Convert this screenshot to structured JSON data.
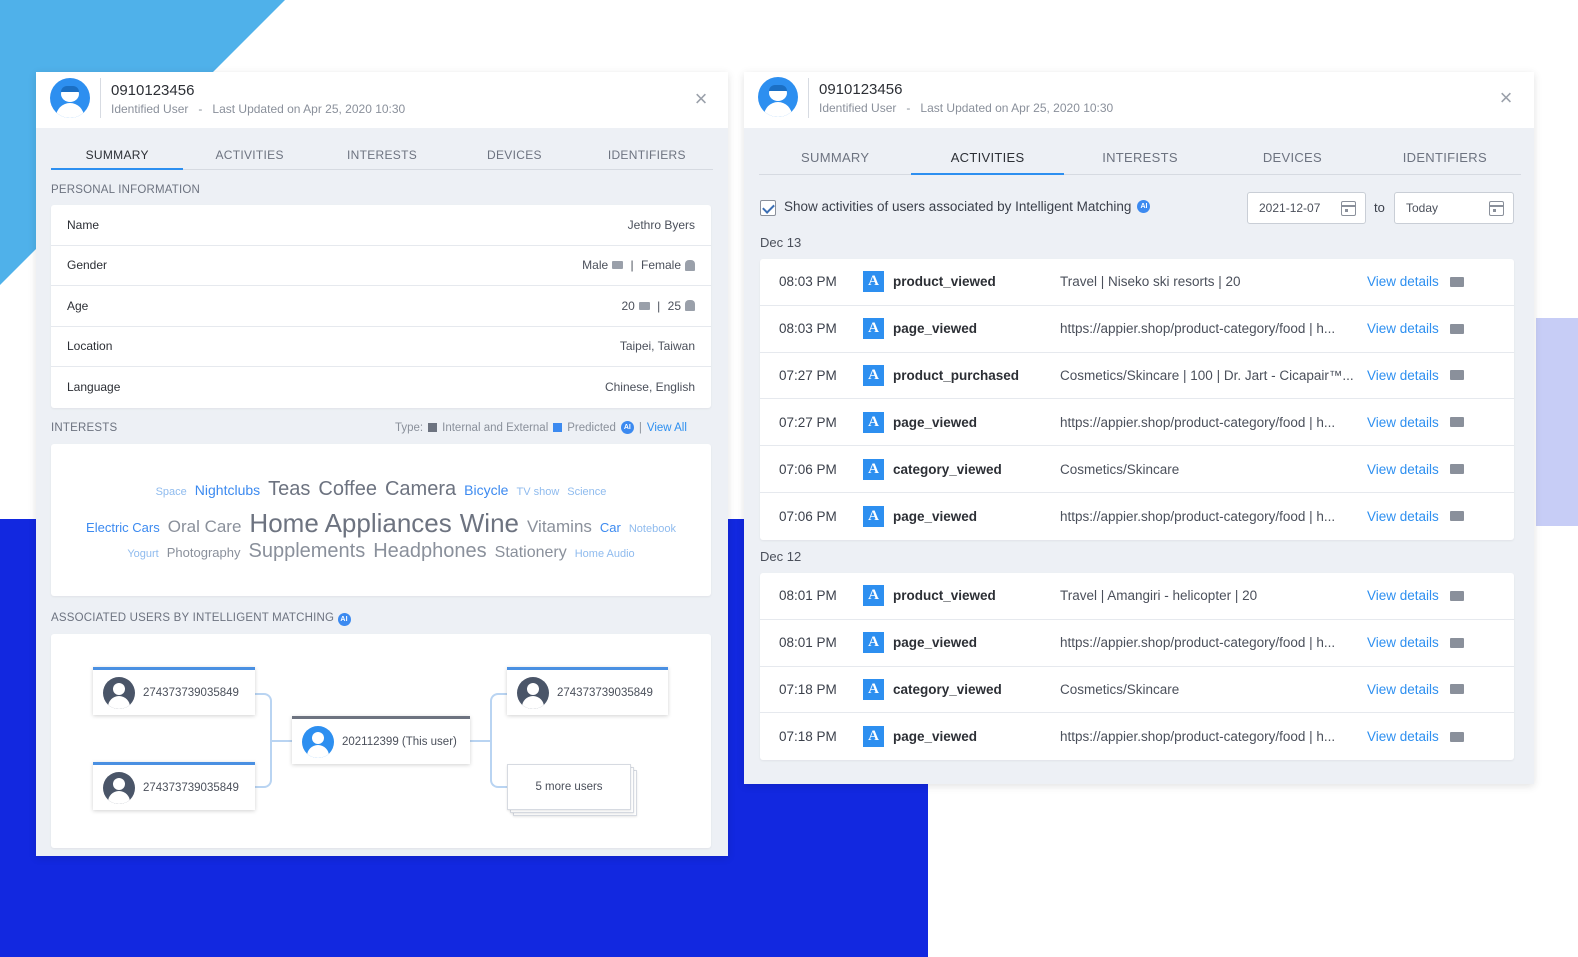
{
  "colors": {
    "accent": "#2d8ff0",
    "background_light_blue": "#4fb1ea",
    "background_dark_blue": "#1228e0",
    "background_lavender": "#c7cdf6",
    "panel_body": "#edf0f5"
  },
  "left_panel": {
    "user_id": "0910123456",
    "user_type": "Identified User",
    "last_updated": "Last Updated on Apr 25, 2020 10:30",
    "close_icon": "close-icon",
    "tabs": [
      {
        "label": "SUMMARY",
        "active": true
      },
      {
        "label": "ACTIVITIES",
        "active": false
      },
      {
        "label": "INTERESTS",
        "active": false
      },
      {
        "label": "DEVICES",
        "active": false
      },
      {
        "label": "IDENTIFIERS",
        "active": false
      }
    ],
    "personal_info": {
      "title": "PERSONAL INFORMATION",
      "rows": [
        {
          "label": "Name",
          "value": "Jethro Byers"
        },
        {
          "label": "Gender",
          "value_a": "Male",
          "value_b": "Female"
        },
        {
          "label": "Age",
          "value_a": "20",
          "value_b": "25"
        },
        {
          "label": "Location",
          "value": "Taipei, Taiwan"
        },
        {
          "label": "Language",
          "value": "Chinese, English"
        }
      ]
    },
    "interests": {
      "title": "INTERESTS",
      "type_label": "Type:",
      "internal_label": "Internal and External",
      "predicted_label": "Predicted",
      "view_all": "View All",
      "badge_text": "AI",
      "lines": [
        [
          {
            "text": "Space",
            "size": 11,
            "color": "#8fbbee"
          },
          {
            "text": "Nightclubs",
            "size": 14,
            "color": "#3c8af0"
          },
          {
            "text": "Teas",
            "size": 20,
            "color": "#6d7380"
          },
          {
            "text": "Coffee",
            "size": 20,
            "color": "#6d7380"
          },
          {
            "text": "Camera",
            "size": 20,
            "color": "#6d7380"
          },
          {
            "text": "Bicycle",
            "size": 14,
            "color": "#3c8af0"
          },
          {
            "text": "TV show",
            "size": 11,
            "color": "#8fbbee"
          },
          {
            "text": "Science",
            "size": 11,
            "color": "#8fbbee"
          }
        ],
        [
          {
            "text": "Electric Cars",
            "size": 13,
            "color": "#3c8af0"
          },
          {
            "text": "Oral Care",
            "size": 17,
            "color": "#8a909b"
          },
          {
            "text": "Home Appliances",
            "size": 26,
            "color": "#6d7380"
          },
          {
            "text": "Wine",
            "size": 26,
            "color": "#6d7380"
          },
          {
            "text": "Vitamins",
            "size": 17,
            "color": "#8a909b"
          },
          {
            "text": "Car",
            "size": 13,
            "color": "#3c8af0"
          },
          {
            "text": "Notebook",
            "size": 11,
            "color": "#8fbbee"
          }
        ],
        [
          {
            "text": "Yogurt",
            "size": 11,
            "color": "#8fbbee"
          },
          {
            "text": "Photography",
            "size": 13,
            "color": "#8a909b"
          },
          {
            "text": "Supplements",
            "size": 20,
            "color": "#8a909b"
          },
          {
            "text": "Headphones",
            "size": 20,
            "color": "#8a909b"
          },
          {
            "text": "Stationery",
            "size": 16,
            "color": "#8a909b"
          },
          {
            "text": "Home Audio",
            "size": 11,
            "color": "#8fbbee"
          }
        ]
      ]
    },
    "associated": {
      "title": "ASSOCIATED USERS BY INTELLIGENT MATCHING",
      "badge_text": "AI",
      "top_left": "274373739035849",
      "bottom_left": "274373739035849",
      "center": "202112399 (This user)",
      "top_right": "274373739035849",
      "more": "5 more users"
    }
  },
  "right_panel": {
    "user_id": "0910123456",
    "user_type": "Identified User",
    "last_updated": "Last Updated on Apr 25, 2020 10:30",
    "close_icon": "close-icon",
    "tabs": [
      {
        "label": "SUMMARY",
        "active": false
      },
      {
        "label": "ACTIVITIES",
        "active": true
      },
      {
        "label": "INTERESTS",
        "active": false
      },
      {
        "label": "DEVICES",
        "active": false
      },
      {
        "label": "IDENTIFIERS",
        "active": false
      }
    ],
    "filter": {
      "checkbox_label": "Show activities of users associated by Intelligent Matching",
      "checked": true,
      "badge_text": "AI",
      "from_date": "2021-12-07",
      "to_label": "to",
      "to_date": "Today"
    },
    "days": [
      {
        "label": "Dec 13",
        "events": [
          {
            "time": "08:03 PM",
            "badge": "A",
            "name": "product_viewed",
            "detail": "Travel | Niseko ski resorts | 20",
            "link": "View details"
          },
          {
            "time": "08:03 PM",
            "badge": "A",
            "name": "page_viewed",
            "detail": "https://appier.shop/product-category/food | h...",
            "link": "View details"
          },
          {
            "time": "07:27 PM",
            "badge": "A",
            "name": "product_purchased",
            "detail": "Cosmetics/Skincare | 100 | Dr. Jart - Cicapair™...",
            "link": "View details"
          },
          {
            "time": "07:27 PM",
            "badge": "A",
            "name": "page_viewed",
            "detail": "https://appier.shop/product-category/food | h...",
            "link": "View details"
          },
          {
            "time": "07:06 PM",
            "badge": "A",
            "name": "category_viewed",
            "detail": "Cosmetics/Skincare",
            "link": "View details"
          },
          {
            "time": "07:06 PM",
            "badge": "A",
            "name": "page_viewed",
            "detail": "https://appier.shop/product-category/food | h...",
            "link": "View details"
          }
        ]
      },
      {
        "label": "Dec 12",
        "events": [
          {
            "time": "08:01 PM",
            "badge": "A",
            "name": "product_viewed",
            "detail": "Travel | Amangiri - helicopter | 20",
            "link": "View details"
          },
          {
            "time": "08:01 PM",
            "badge": "A",
            "name": "page_viewed",
            "detail": "https://appier.shop/product-category/food | h...",
            "link": "View details"
          },
          {
            "time": "07:18 PM",
            "badge": "A",
            "name": "category_viewed",
            "detail": "Cosmetics/Skincare",
            "link": "View details"
          },
          {
            "time": "07:18 PM",
            "badge": "A",
            "name": "page_viewed",
            "detail": "https://appier.shop/product-category/food | h...",
            "link": "View details"
          }
        ]
      }
    ]
  }
}
